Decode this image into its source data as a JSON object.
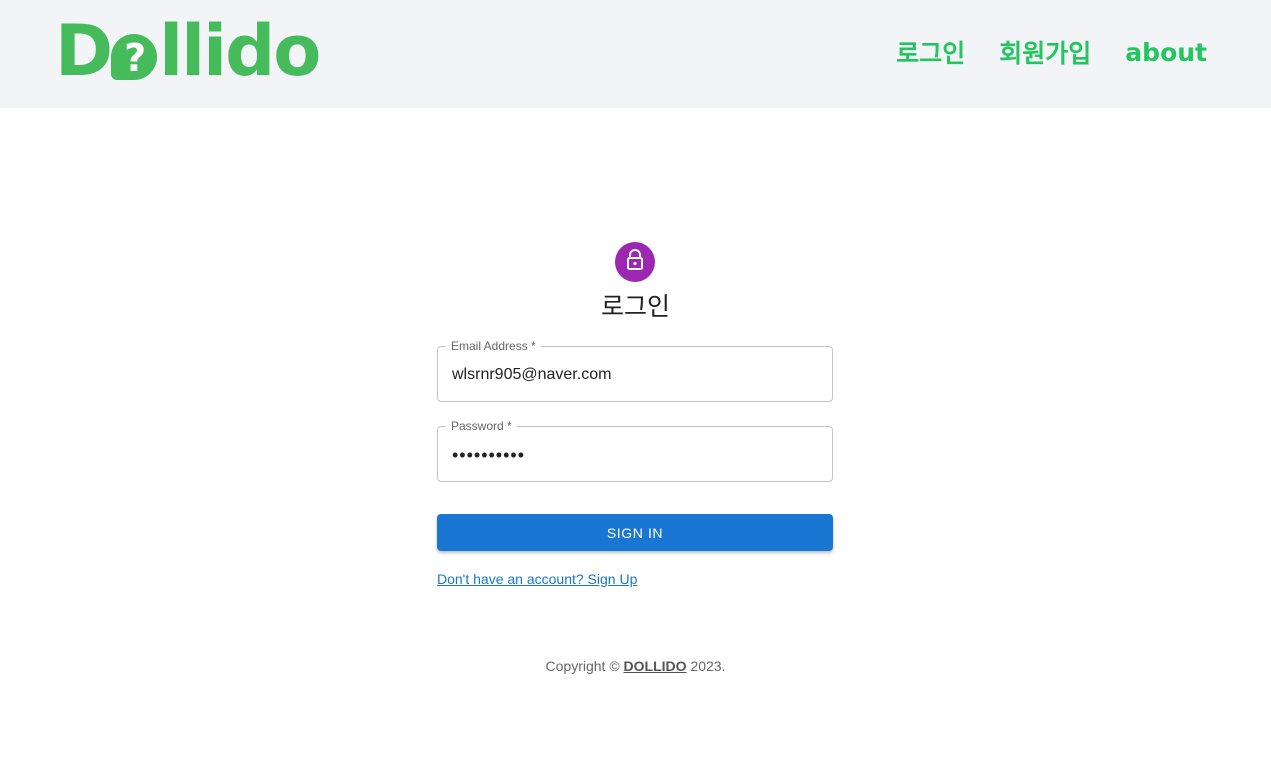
{
  "header": {
    "logo": {
      "part1": "D",
      "bubble": "?",
      "part2": "llido"
    },
    "nav": {
      "login": "로그인",
      "signup": "회원가입",
      "about": "about"
    }
  },
  "form": {
    "title": "로그인",
    "email": {
      "label": "Email Address *",
      "value": "wlsrnr905@naver.com"
    },
    "password": {
      "label": "Password *",
      "value": "••••••••••"
    },
    "submit_label": "SIGN IN",
    "signup_link": "Don't have an account? Sign Up"
  },
  "footer": {
    "prefix": "Copyright © ",
    "brand": "DOLLIDO",
    "suffix": " 2023."
  },
  "colors": {
    "brand_green": "#45bb5c",
    "nav_green": "#22c55e",
    "avatar_purple": "#9c27b0",
    "primary_blue": "#1976d2",
    "header_bg": "#f3f4f8"
  },
  "icons": {
    "avatar": "lock-icon"
  }
}
